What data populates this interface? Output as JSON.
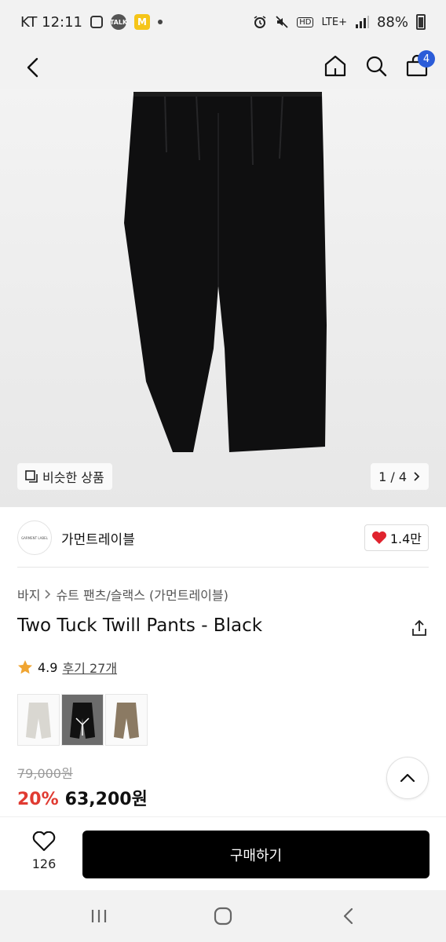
{
  "status_bar": {
    "carrier_time": "KT 12:11",
    "network": "LTE+",
    "battery": "88%",
    "icons": [
      "calendar-icon",
      "kakaotalk-icon",
      "m-app-icon",
      "alarm-icon",
      "mute-icon",
      "hd-icon",
      "signal-icon",
      "battery-icon"
    ]
  },
  "nav": {
    "cart_count": "4",
    "icons": [
      "back-icon",
      "home-icon",
      "search-icon",
      "cart-icon"
    ]
  },
  "hero": {
    "similar_label": "비슷한 상품",
    "pager": "1 / 4"
  },
  "brand": {
    "logo_text": "GARMENT LABEL",
    "name": "가먼트레이블",
    "likes": "1.4만"
  },
  "breadcrumb": {
    "items": [
      "바지",
      "슈트 팬츠/슬랙스 (가먼트레이블)"
    ]
  },
  "product": {
    "title": "Two Tuck Twill Pants - Black",
    "rating": "4.9",
    "reviews_label": "후기 27개",
    "swatches": [
      "light-gray",
      "black",
      "beige"
    ],
    "original_price": "79,000원",
    "discount": "20%",
    "sale_price": "63,200원"
  },
  "actions": {
    "wish_count": "126",
    "buy_label": "구매하기"
  },
  "colors": {
    "accent_blue": "#2b5cd8",
    "discount_red": "#e03b32",
    "heart_red": "#e0232e",
    "star_gold": "#f0a531",
    "button_black": "#000000"
  }
}
